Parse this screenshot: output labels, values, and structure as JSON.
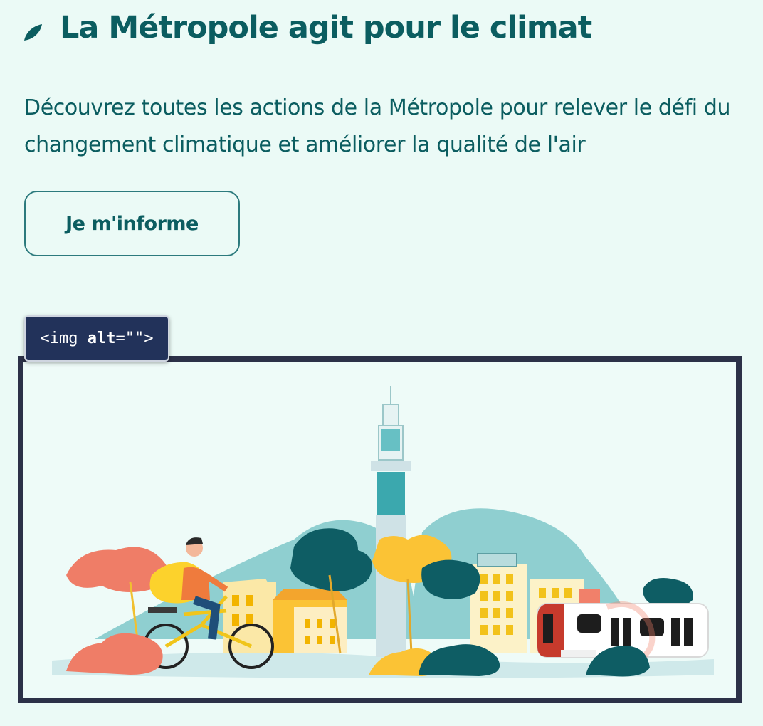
{
  "header": {
    "icon": "leaf-icon",
    "title": "La Métropole agit pour le climat"
  },
  "intro": {
    "text": "Découvrez toutes les actions de la Métropole pour relever le défi du changement climatique et améliorer la qualité de l'air"
  },
  "cta": {
    "label": "Je m'informe"
  },
  "image_overlay": {
    "tag_open": "<img ",
    "attr": "alt",
    "tag_close": "=\"\">"
  },
  "colors": {
    "background": "#ebfaf6",
    "text": "#0b5d60",
    "button_border": "#2c7a7d",
    "tag_background": "#22325a",
    "frame_border": "#2c3148"
  }
}
